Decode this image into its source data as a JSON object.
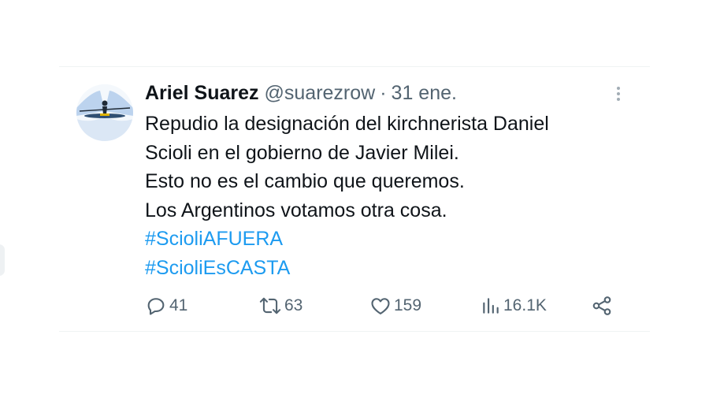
{
  "tweet": {
    "author_name": "Ariel Suarez",
    "handle": "@suarezrow",
    "separator": "·",
    "date": "31 ene.",
    "lines": [
      "Repudio la designación del kirchnerista Daniel",
      "Scioli en el gobierno de Javier Milei.",
      "Esto no es el cambio que queremos.",
      "Los Argentinos votamos otra cosa."
    ],
    "hashtags": [
      "#ScioliAFUERA",
      "#ScioliEsCASTA"
    ],
    "actions": {
      "replies": "41",
      "retweets": "63",
      "likes": "159",
      "views": "16.1K"
    },
    "icons": {
      "reply": "reply-icon",
      "retweet": "retweet-icon",
      "like": "heart-icon",
      "views": "views-chart-icon",
      "share": "share-icon",
      "more": "more-vertical-icon"
    },
    "colors": {
      "text": "#0f1419",
      "muted": "#536471",
      "hashtag": "#1d9bf0",
      "divider": "#eff3f4"
    }
  }
}
